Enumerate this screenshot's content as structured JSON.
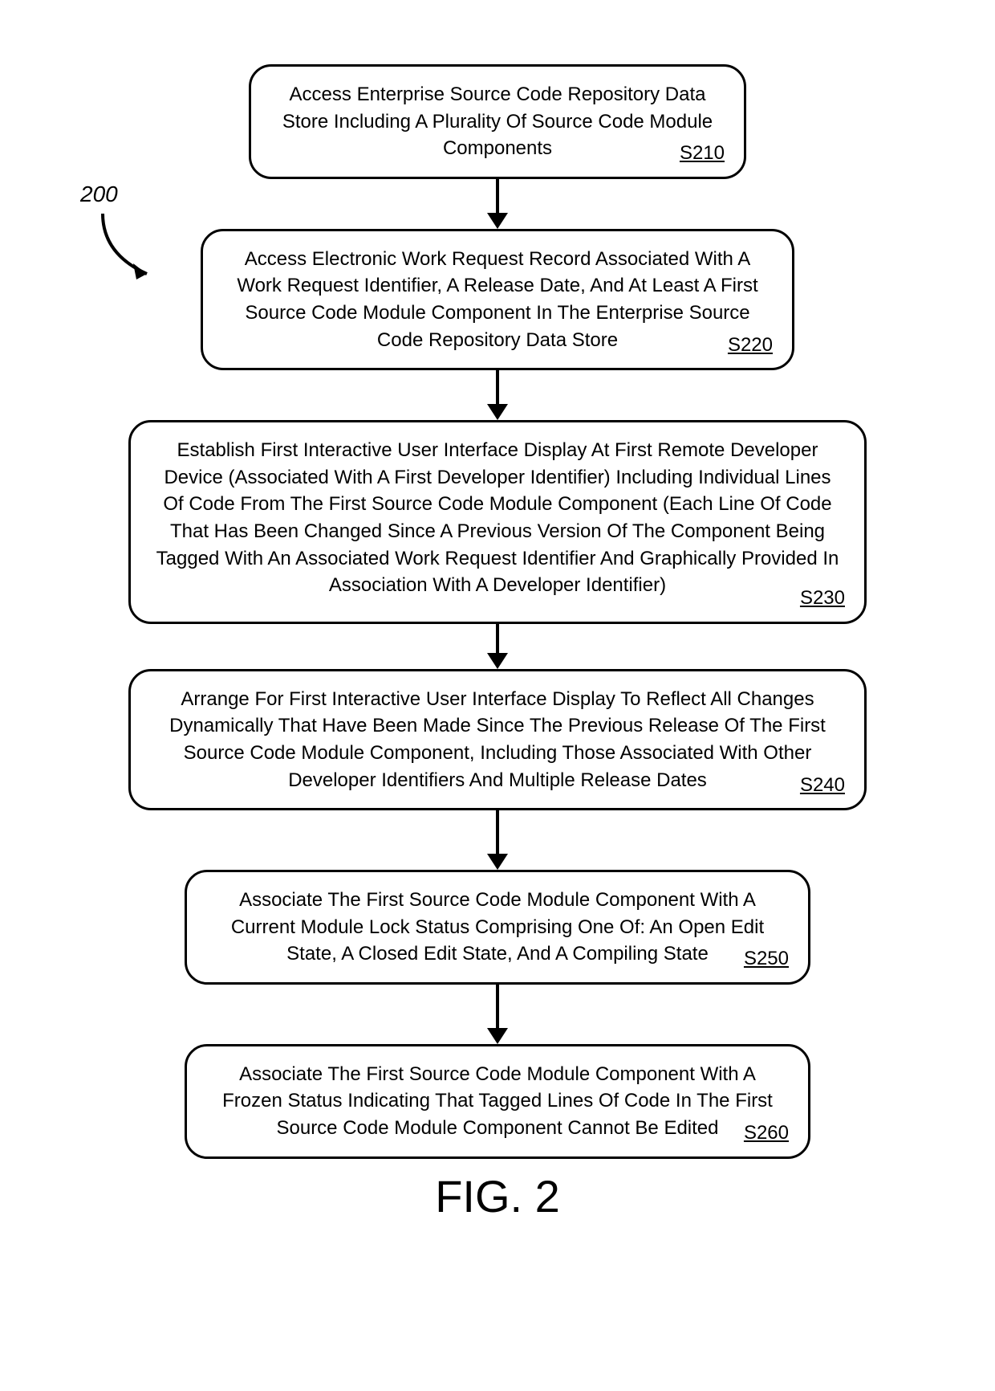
{
  "flow_ref": {
    "number": "200"
  },
  "steps": {
    "s210": {
      "text": "Access Enterprise Source Code Repository Data Store Including A Plurality Of Source Code Module Components",
      "label": "S210"
    },
    "s220": {
      "text": "Access Electronic Work Request Record Associated With A Work Request Identifier, A Release Date, And At Least A First Source Code Module Component In The Enterprise Source Code Repository Data Store",
      "label": "S220"
    },
    "s230": {
      "text": "Establish First Interactive User Interface Display At First Remote Developer Device (Associated With A First Developer Identifier) Including Individual Lines Of Code From The First Source Code Module Component (Each Line Of Code That Has Been Changed Since A Previous Version Of The Component Being Tagged With An Associated Work Request Identifier And Graphically Provided In Association With A Developer Identifier)",
      "label": "S230"
    },
    "s240": {
      "text": "Arrange For First Interactive User Interface Display To Reflect All Changes Dynamically That Have Been Made Since The Previous Release Of The First Source Code Module Component, Including Those Associated With Other Developer Identifiers And Multiple Release Dates",
      "label": "S240"
    },
    "s250": {
      "text": "Associate The First Source Code Module Component With A Current Module Lock Status Comprising One Of: An Open Edit State, A Closed Edit State, And A Compiling State",
      "label": "S250"
    },
    "s260": {
      "text": "Associate The First Source Code Module Component With A Frozen Status Indicating That Tagged Lines Of Code In The First Source Code Module Component Cannot Be Edited",
      "label": "S260"
    }
  },
  "figure_caption": "FIG. 2"
}
